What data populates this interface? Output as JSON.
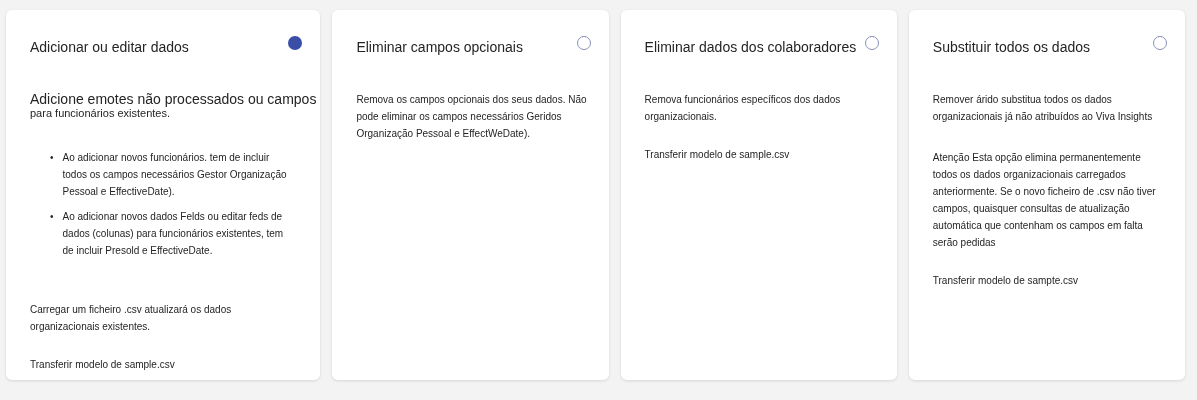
{
  "cards": [
    {
      "title": "Adicionar ou editar dados",
      "selected": true,
      "blocks": [
        {
          "kind": "lead",
          "text": "Adicione emotes não processados ou campos",
          "subtext": "para funcionários existentes."
        },
        {
          "kind": "list",
          "bullet": "•",
          "items": [
            "Ao adicionar novos funcionários. tem de incluir todos os campos necessários Gestor Organização Pessoal e EffectiveDate).",
            "Ao adicionar novos dados Felds ou editar feds de dados (colunas) para funcionários existentes, tem de incluir Presold e EffectiveDate."
          ]
        },
        {
          "kind": "text",
          "text": "Carregar um ficheiro .csv atualizará os dados organizacionais existentes."
        },
        {
          "kind": "link",
          "text": "Transferir modelo de sample.csv"
        }
      ]
    },
    {
      "title": "Eliminar campos opcionais",
      "selected": false,
      "blocks": [
        {
          "kind": "text",
          "text": "Remova os campos opcionais dos seus dados. Não pode eliminar os campos necessários Geridos Organização Pessoal e EffectWeDate)."
        }
      ]
    },
    {
      "title": "Eliminar dados dos colaboradores",
      "selected": false,
      "blocks": [
        {
          "kind": "text",
          "text": "Remova funcionários específicos dos dados organizacionais."
        },
        {
          "kind": "link",
          "text": "Transferir modelo de sample.csv"
        }
      ]
    },
    {
      "title": "Substituir todos os dados",
      "selected": false,
      "blocks": [
        {
          "kind": "text",
          "text": "Remover árido substitua todos os dados organizacionais já não atribuídos ao Viva Insights"
        },
        {
          "kind": "text",
          "text": "Atenção Esta opção elimina permanentemente todos os dados organizacionais carregados anteriormente. Se o novo ficheiro de .csv não tiver campos, quaisquer consultas de atualização automática que contenham os campos em falta serão pedidas"
        },
        {
          "kind": "link",
          "text": "Transferir modelo de sampte.csv"
        }
      ]
    }
  ]
}
